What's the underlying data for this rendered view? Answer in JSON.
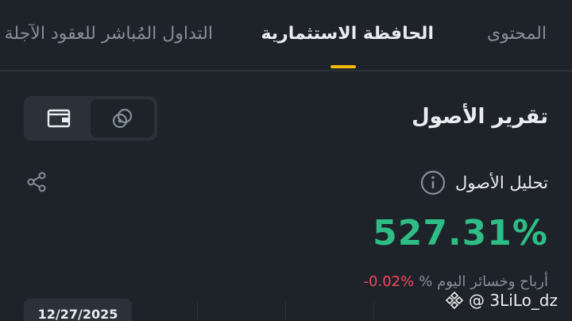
{
  "tabs": [
    {
      "label": "المحتوى",
      "active": false
    },
    {
      "label": "الحافظة الاستثمارية",
      "active": true
    },
    {
      "label": "التداول المُباشر للعقود الآجلة",
      "active": false
    }
  ],
  "accent_color": "#f0b90b",
  "toggle": {
    "options": [
      "wallet-icon",
      "chain-link-icon"
    ],
    "selected": "chain-link-icon"
  },
  "report": {
    "title": "تقرير الأصول",
    "analysis_label": "تحليل الأصول",
    "total_return": "527.31%",
    "today_pnl_label": "أرباح وخسائر اليوم %",
    "today_pnl_value": "-0.02%"
  },
  "chart": {
    "date": "12/27/2025"
  },
  "colors": {
    "positive": "#2ebd85",
    "negative": "#f6465d",
    "background": "#1e2329"
  },
  "watermark": {
    "text": "@ 3LiLo_dz"
  }
}
